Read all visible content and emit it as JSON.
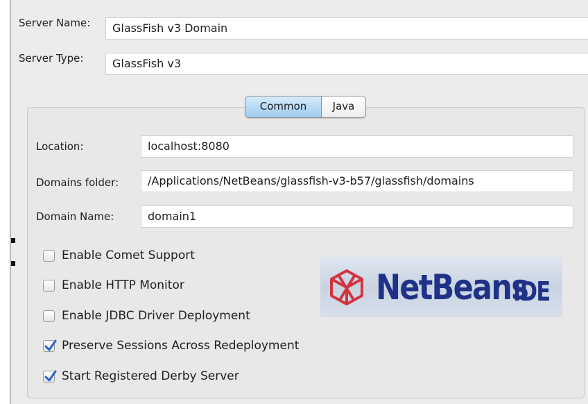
{
  "server": {
    "name_label": "Server Name:",
    "name_value": "GlassFish v3 Domain",
    "type_label": "Server Type:",
    "type_value": "GlassFish v3"
  },
  "tabs": {
    "items": [
      {
        "label": "Common",
        "selected": true
      },
      {
        "label": "Java",
        "selected": false
      }
    ]
  },
  "common": {
    "location_label": "Location:",
    "location_value": "localhost:8080",
    "domains_folder_label": "Domains folder:",
    "domains_folder_value": "/Applications/NetBeans/glassfish-v3-b57/glassfish/domains",
    "domain_name_label": "Domain Name:",
    "domain_name_value": "domain1"
  },
  "options": [
    {
      "label": "Enable Comet Support",
      "checked": false
    },
    {
      "label": "Enable HTTP Monitor",
      "checked": false
    },
    {
      "label": "Enable JDBC Driver Deployment",
      "checked": false
    },
    {
      "label": "Preserve Sessions Across Redeployment",
      "checked": true
    },
    {
      "label": "Start Registered Derby Server",
      "checked": true
    }
  ],
  "logo": {
    "text": "NetBeans",
    "suffix": "IDE",
    "icon": "netbeans-cube-icon"
  },
  "colors": {
    "selected_tab": "#9ecbef",
    "logo_text": "#1f3288",
    "logo_icon": "#d2343f",
    "checkmark": "#2b62c9"
  }
}
